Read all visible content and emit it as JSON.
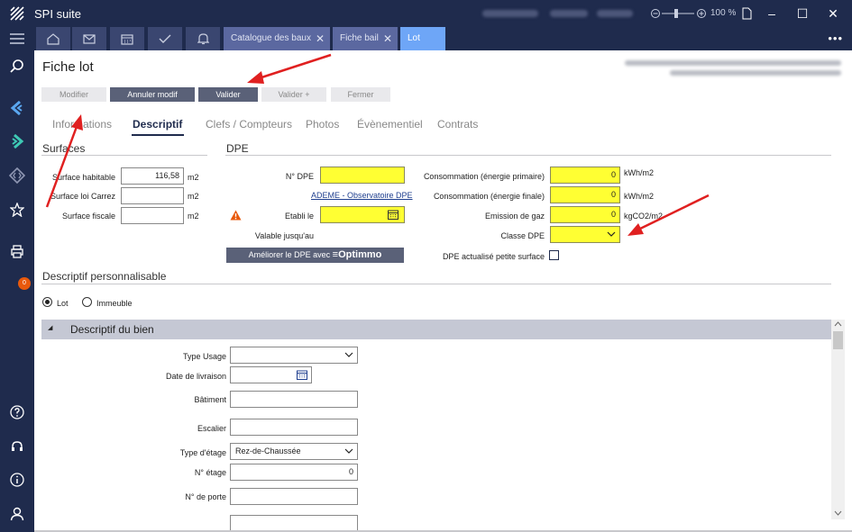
{
  "app": {
    "title": "SPI suite",
    "zoom": "100 %"
  },
  "tabs": [
    {
      "label": "Catalogue des baux",
      "closable": true
    },
    {
      "label": "Fiche bail",
      "closable": true
    },
    {
      "label": "Lot",
      "closable": false,
      "active": true
    }
  ],
  "sidebar": {
    "badge_count": "0"
  },
  "header": {
    "title": "Fiche lot"
  },
  "toolbar": {
    "modifier": "Modifier",
    "annuler": "Annuler modif",
    "valider": "Valider",
    "valider_plus": "Valider +",
    "fermer": "Fermer"
  },
  "subtabs": [
    "Informations",
    "Descriptif",
    "Clefs / Compteurs",
    "Photos",
    "Évènementiel",
    "Contrats"
  ],
  "surfaces": {
    "title": "Surfaces",
    "habitable_label": "Surface habitable",
    "habitable_value": "116,58",
    "carrez_label": "Surface loi Carrez",
    "carrez_value": "",
    "fiscale_label": "Surface fiscale",
    "fiscale_value": "",
    "unit": "m2"
  },
  "dpe": {
    "title": "DPE",
    "num_label": "N° DPE",
    "num_value": "",
    "ademe_link": "ADEME - Observatoire DPE",
    "etabli_label": "Etabli le",
    "valable_label": "Valable jusqu'au",
    "optimmo_prefix": "Améliorer le DPE avec ",
    "optimmo_brand": "≡Optimmo",
    "conso_primaire_label": "Consommation (énergie primaire)",
    "conso_primaire_value": "0",
    "conso_primaire_unit": "kWh/m2",
    "conso_finale_label": "Consommation (énergie finale)",
    "conso_finale_value": "0",
    "conso_finale_unit": "kWh/m2",
    "emission_label": "Emission de gaz",
    "emission_value": "0",
    "emission_unit": "kgCO2/m2",
    "classe_label": "Classe DPE",
    "classe_value": "",
    "petite_surface_label": "DPE actualisé petite surface"
  },
  "descriptif": {
    "title": "Descriptif personnalisable",
    "radio_lot": "Lot",
    "radio_immeuble": "Immeuble",
    "group_title": "Descriptif du bien",
    "type_usage_label": "Type Usage",
    "type_usage_value": "",
    "livraison_label": "Date de livraison",
    "livraison_value": "",
    "batiment_label": "Bâtiment",
    "batiment_value": "",
    "escalier_label": "Escalier",
    "escalier_value": "",
    "type_etage_label": "Type d'étage",
    "type_etage_value": "Rez-de-Chaussée",
    "num_etage_label": "N° étage",
    "num_etage_value": "0",
    "num_porte_label": "N° de porte",
    "num_porte_value": ""
  },
  "colors": {
    "sidebar": "#1f2b4d",
    "active_tab": "#6ea6f7",
    "highlight": "#ffff33",
    "annotation": "#e02020"
  }
}
